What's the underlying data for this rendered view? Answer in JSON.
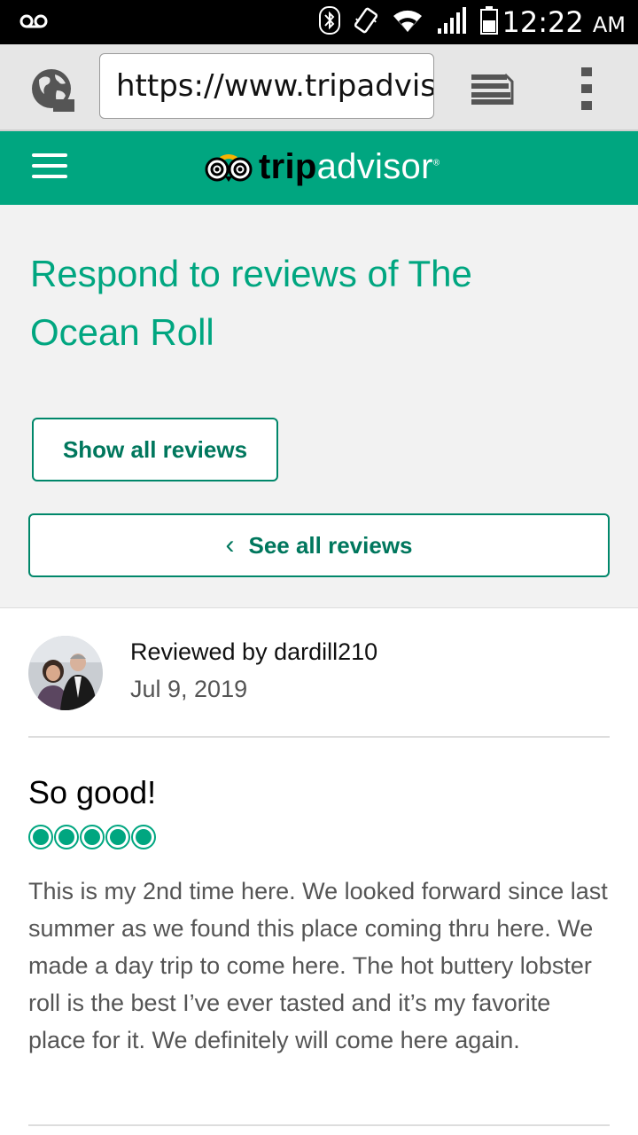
{
  "status_bar": {
    "time": "12:22",
    "ampm": "AM",
    "icons": [
      "voicemail-icon",
      "bluetooth-icon",
      "vibrate-icon",
      "wifi-icon",
      "signal-icon",
      "battery-icon"
    ]
  },
  "browser": {
    "url": "https://www.tripadvisor.com",
    "icons": [
      "globe-icon",
      "tabs-icon",
      "overflow-menu-icon"
    ]
  },
  "header": {
    "logo_part1": "trip",
    "logo_part2": "advisor",
    "logo_mark": "®",
    "brand_color": "#00a680"
  },
  "page": {
    "title": "Respond to reviews of The Ocean Roll",
    "show_all_label": "Show all reviews",
    "see_all_label": "See all reviews",
    "see_all_chevron": "‹"
  },
  "review": {
    "reviewed_by": "Reviewed by dardill210",
    "date": "Jul 9, 2019",
    "title": "So good!",
    "rating": 5,
    "rating_max": 5,
    "body": "This is my 2nd time here. We looked forward since last summer as we found this place coming thru here. We made a day trip to come here. The hot buttery lobster roll is the best I’ve ever tasted and it’s my favorite place for it. We definitely will come here again."
  }
}
